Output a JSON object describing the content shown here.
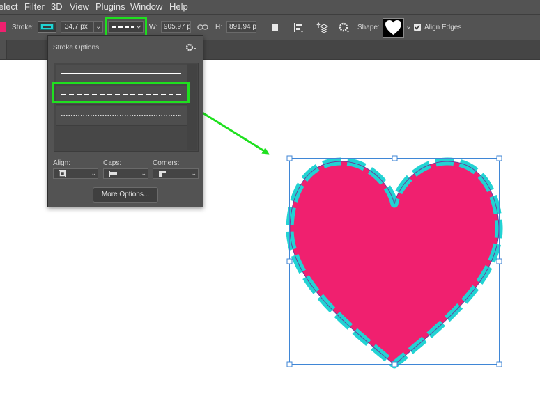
{
  "menu": [
    "elect",
    "Filter",
    "3D",
    "View",
    "Plugins",
    "Window",
    "Help"
  ],
  "options_bar": {
    "stroke_label": "Stroke:",
    "stroke_width": "34,7 px",
    "w_label": "W:",
    "w_value": "905,97 p",
    "h_label": "H:",
    "h_value": "891,94 p",
    "shape_label": "Shape:",
    "align_edges_label": "Align Edges",
    "align_edges_checked": true
  },
  "stroke_options_panel": {
    "title": "Stroke Options",
    "line_styles": [
      "solid",
      "dashed",
      "dotted"
    ],
    "selected_style": "dashed",
    "align_label": "Align:",
    "caps_label": "Caps:",
    "corners_label": "Corners:",
    "more_options_label": "More Options..."
  },
  "colors": {
    "fill": "#f0206f",
    "stroke": "#22d3d3",
    "highlight": "#1fe01f",
    "ui_bg": "#535353",
    "bbox": "#3f86d6"
  }
}
